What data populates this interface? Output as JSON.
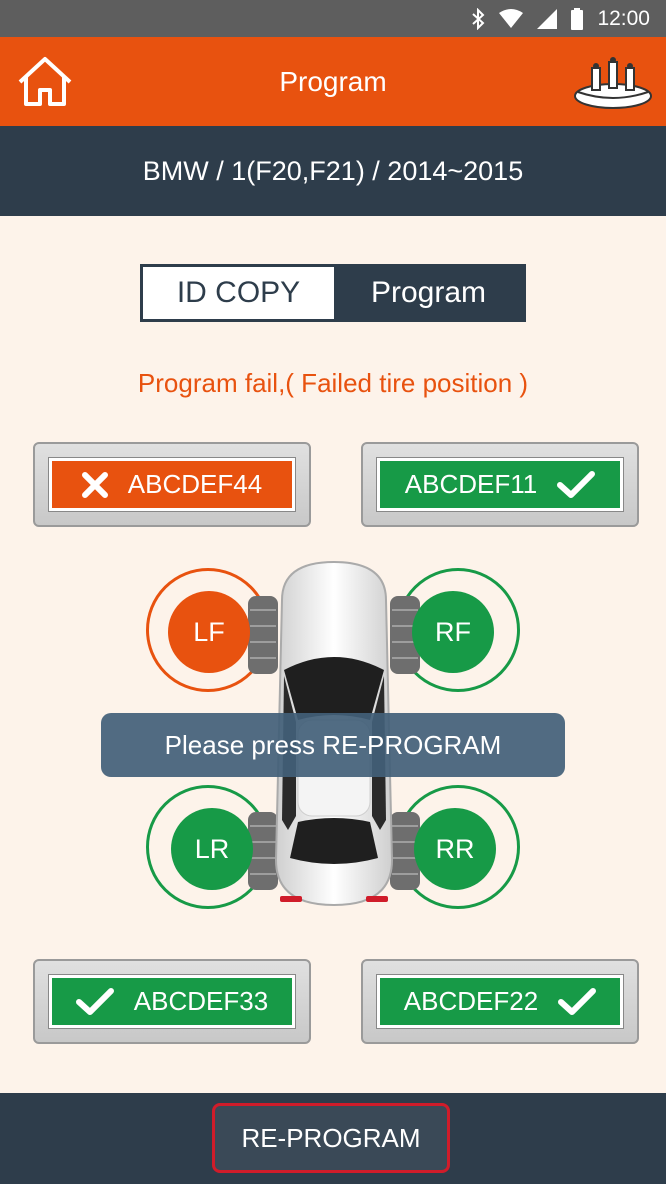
{
  "status_bar": {
    "time": "12:00",
    "icons": [
      "bluetooth-icon",
      "wifi-icon",
      "signal-icon",
      "battery-icon"
    ]
  },
  "app_bar": {
    "title": "Program",
    "home_icon": "home-icon",
    "logo_icon": "tpms-logo-icon"
  },
  "vehicle": {
    "label": "BMW / 1(F20,F21) / 2014~2015"
  },
  "segmented": {
    "left": "ID COPY",
    "right": "Program",
    "selected": "Program"
  },
  "message": "Program fail,( Failed tire position )",
  "sensors": {
    "lf": {
      "id": "ABCDEF44",
      "status": "fail",
      "wheel_label": "LF"
    },
    "rf": {
      "id": "ABCDEF11",
      "status": "ok",
      "wheel_label": "RF"
    },
    "lr": {
      "id": "ABCDEF33",
      "status": "ok",
      "wheel_label": "LR"
    },
    "rr": {
      "id": "ABCDEF22",
      "status": "ok",
      "wheel_label": "RR"
    }
  },
  "toast": "Please press RE-PROGRAM",
  "bottom": {
    "reprogram_label": "RE-PROGRAM"
  },
  "colors": {
    "accent": "#e8520f",
    "dark": "#2e3d4b",
    "ok": "#179a47",
    "background": "#fdf3ea",
    "highlight": "#d01c2a"
  }
}
